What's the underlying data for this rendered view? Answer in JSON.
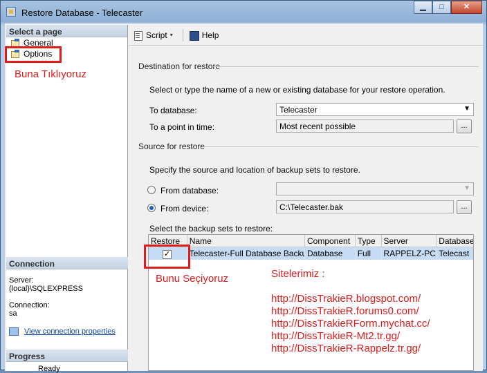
{
  "window": {
    "title": "Restore Database - Telecaster",
    "controls": {
      "minimize": "▁",
      "maximize": "□",
      "close": "✕"
    }
  },
  "left": {
    "select_page_header": "Select a page",
    "pages": [
      {
        "label": "General"
      },
      {
        "label": "Options"
      }
    ],
    "annotation_click": "Buna Tıklıyoruz",
    "connection_header": "Connection",
    "server_label": "Server:",
    "server_value": "(local)\\SQLEXPRESS",
    "connection_label": "Connection:",
    "connection_value": "sa",
    "view_link": "View connection properties",
    "progress_header": "Progress",
    "progress_status": "Ready"
  },
  "toolbar": {
    "script_label": "Script",
    "help_label": "Help"
  },
  "destination": {
    "section": "Destination for restore",
    "instructions": "Select or type the name of a new or existing database for your restore operation.",
    "to_database_label": "To database:",
    "to_database_value": "Telecaster",
    "point_in_time_label": "To a point in time:",
    "point_in_time_value": "Most recent possible",
    "browse_label": "..."
  },
  "source": {
    "section": "Source for restore",
    "instructions": "Specify the source and location of backup sets to restore.",
    "from_database_label": "From database:",
    "from_database_value": "",
    "from_device_label": "From device:",
    "from_device_value": "C:\\Telecaster.bak",
    "browse_label": "...",
    "backup_sets_label": "Select the backup sets to restore:"
  },
  "grid": {
    "columns": [
      "Restore",
      "Name",
      "Component",
      "Type",
      "Server",
      "Database"
    ],
    "rows": [
      {
        "restore": "✓",
        "name": "Telecaster-Full Database Backup",
        "component": "Database",
        "type": "Full",
        "server": "RAPPELZ-PC",
        "database": "Telecast"
      }
    ]
  },
  "annotations": {
    "select_note": "Bunu Seçiyoruz",
    "sites_title": "Sitelerimiz :",
    "sites": [
      "http://DissTrakieR.blogspot.com/",
      "http://DissTrakieR.forums0.com/",
      "http://DissTrakieRForm.mychat.cc/",
      "http://DissTrakieR-Mt2.tr.gg/",
      "http://DissTrakieR-Rappelz.tr.gg/"
    ]
  }
}
